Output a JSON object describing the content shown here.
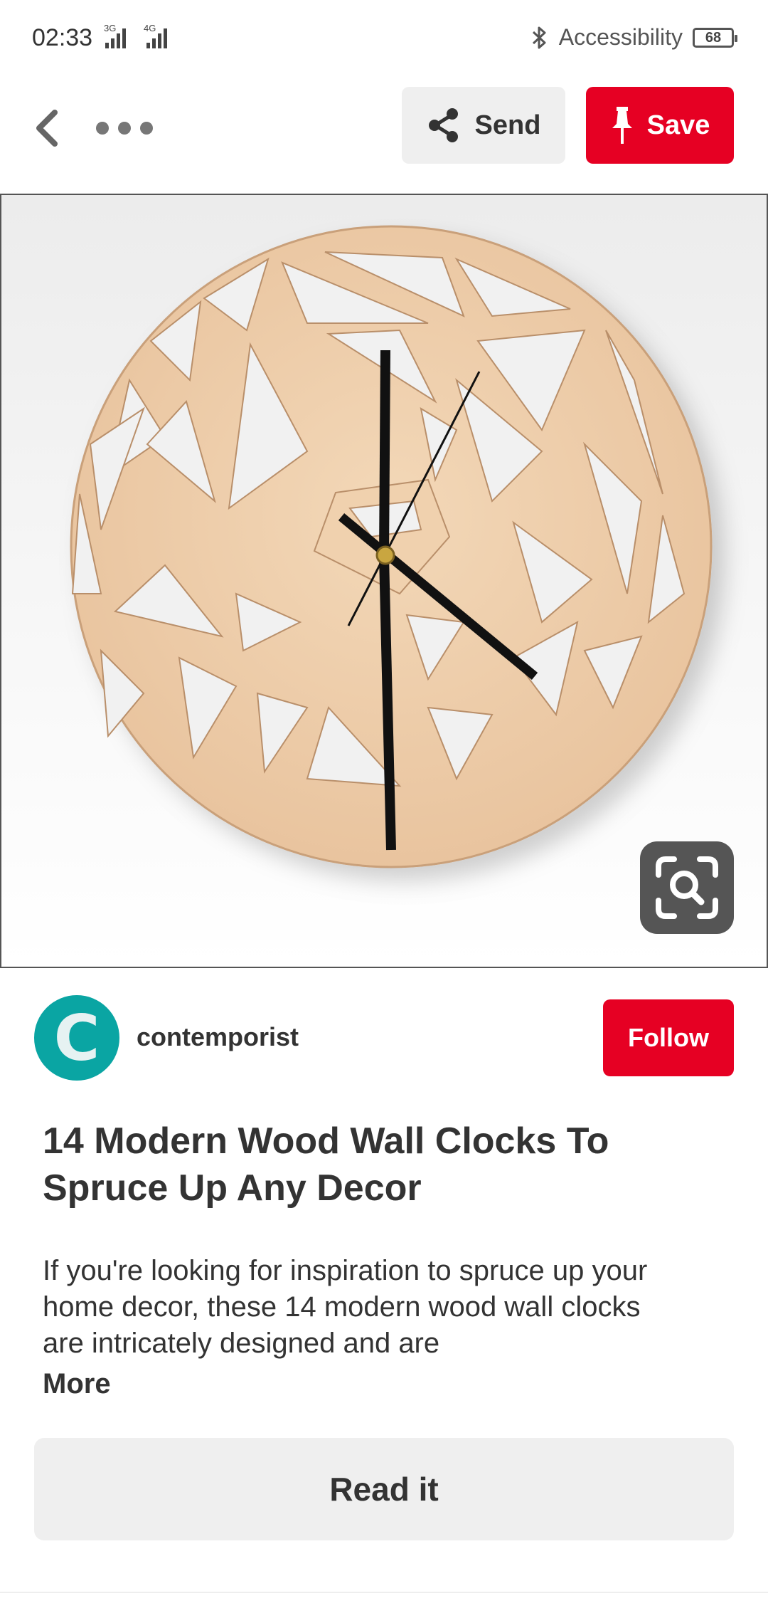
{
  "status_bar": {
    "time": "02:33",
    "signal1_label": "3G",
    "signal2_label": "4G",
    "accessibility_label": "Accessibility",
    "battery_level": "68"
  },
  "action_bar": {
    "send_label": "Send",
    "save_label": "Save"
  },
  "creator": {
    "avatar_letter": "C",
    "name": "contemporist",
    "follow_label": "Follow"
  },
  "pin": {
    "title": "14 Modern Wood Wall Clocks To Spruce Up Any Decor",
    "description": "If you're looking for inspiration to spruce up your home decor, these 14 modern wood wall clocks are intricately designed and are",
    "more_label": "More",
    "read_button_label": "Read it"
  },
  "colors": {
    "brand_red": "#e60023",
    "avatar_teal": "#0aa5a3",
    "button_gray": "#efefef"
  }
}
